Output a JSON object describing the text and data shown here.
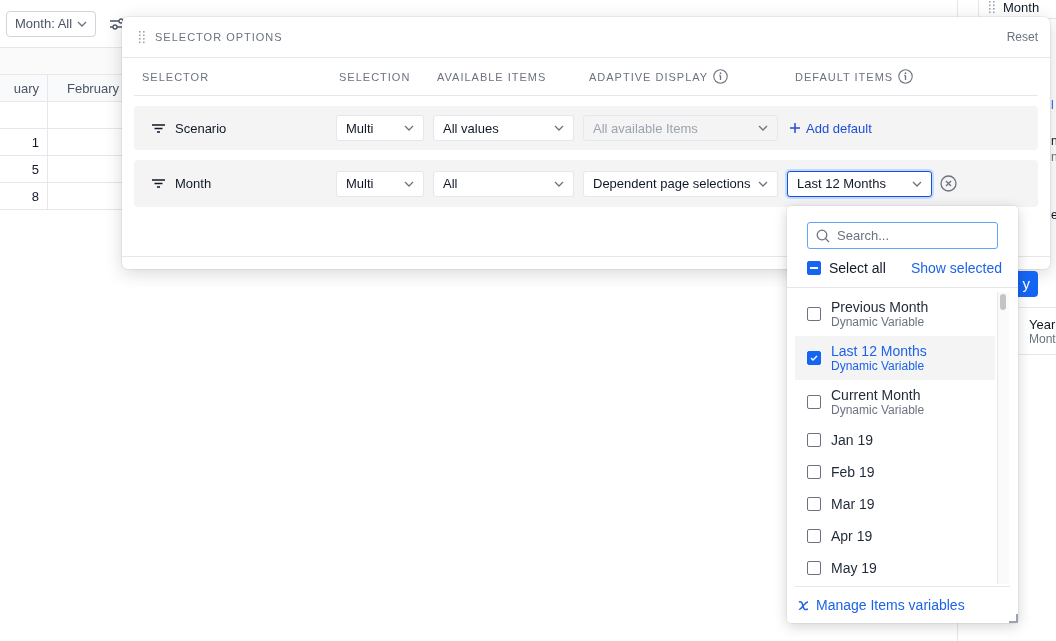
{
  "toolbar": {
    "filter_button": "Month: All"
  },
  "table": {
    "columns": [
      "uary",
      "February"
    ],
    "rows": [
      [
        "",
        ""
      ],
      [
        "1",
        ""
      ],
      [
        "5",
        ""
      ],
      [
        "8",
        ""
      ]
    ]
  },
  "side_panel": {
    "title": "Month",
    "fragments": [
      {
        "kind": "link",
        "text": "l"
      },
      {
        "kind": "title",
        "text": "n"
      },
      {
        "kind": "sub",
        "text": "n"
      },
      {
        "kind": "title",
        "text": "e"
      }
    ],
    "card": {
      "title": "Year",
      "subtitle": "Mont"
    }
  },
  "dialog": {
    "title": "SELECTOR OPTIONS",
    "reset": "Reset",
    "columns": [
      {
        "label": "SELECTOR"
      },
      {
        "label": "SELECTION"
      },
      {
        "label": "AVAILABLE ITEMS"
      },
      {
        "label": "ADAPTIVE DISPLAY",
        "info": true
      },
      {
        "label": "DEFAULT ITEMS",
        "info": true
      }
    ],
    "rows": [
      {
        "name": "Scenario",
        "selection": "Multi",
        "available_items": "All values",
        "adaptive_display": {
          "value": "All available Items",
          "disabled": true
        },
        "default": {
          "kind": "add",
          "label": "Add default"
        }
      },
      {
        "name": "Month",
        "selection": "Multi",
        "available_items": "All",
        "adaptive_display": {
          "value": "Dependent page selections",
          "disabled": false
        },
        "default": {
          "kind": "select",
          "value": "Last 12 Months",
          "focused": true
        }
      }
    ],
    "apply_button": "y"
  },
  "dropdown": {
    "search_placeholder": "Search...",
    "select_all": {
      "label": "Select all",
      "indeterminate": true
    },
    "show_selected": "Show selected",
    "items": [
      {
        "label": "Previous Month",
        "subtitle": "Dynamic Variable",
        "checked": false,
        "selected": false
      },
      {
        "label": "Last 12 Months",
        "subtitle": "Dynamic Variable",
        "checked": true,
        "selected": true
      },
      {
        "label": "Current Month",
        "subtitle": "Dynamic Variable",
        "checked": false,
        "selected": false
      },
      {
        "label": "Jan 19",
        "checked": false,
        "selected": false
      },
      {
        "label": "Feb 19",
        "checked": false,
        "selected": false
      },
      {
        "label": "Mar 19",
        "checked": false,
        "selected": false
      },
      {
        "label": "Apr 19",
        "checked": false,
        "selected": false
      },
      {
        "label": "May 19",
        "checked": false,
        "selected": false
      }
    ],
    "footer_link": "Manage Items variables"
  }
}
